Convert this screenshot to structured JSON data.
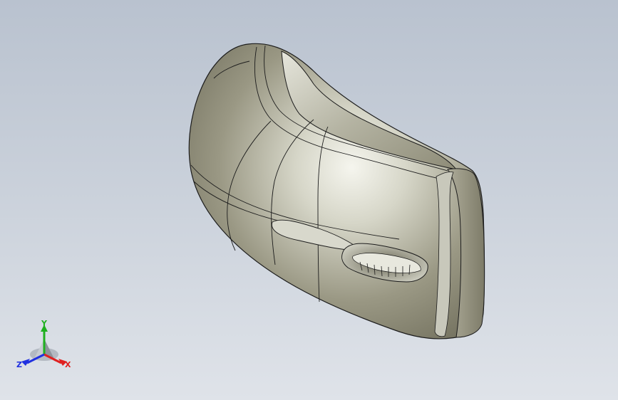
{
  "viewport": {
    "background_top": "#b9c2cf",
    "background_bottom": "#dfe3e9"
  },
  "model": {
    "body_color": "#8c8a74",
    "highlight_color": "#f2f2ea",
    "edge_color": "#1c1c1c"
  },
  "triad": {
    "x_label": "X",
    "y_label": "Y",
    "z_label": "Z",
    "x_color": "#e02020",
    "y_color": "#1fb01f",
    "z_color": "#2030e0"
  }
}
